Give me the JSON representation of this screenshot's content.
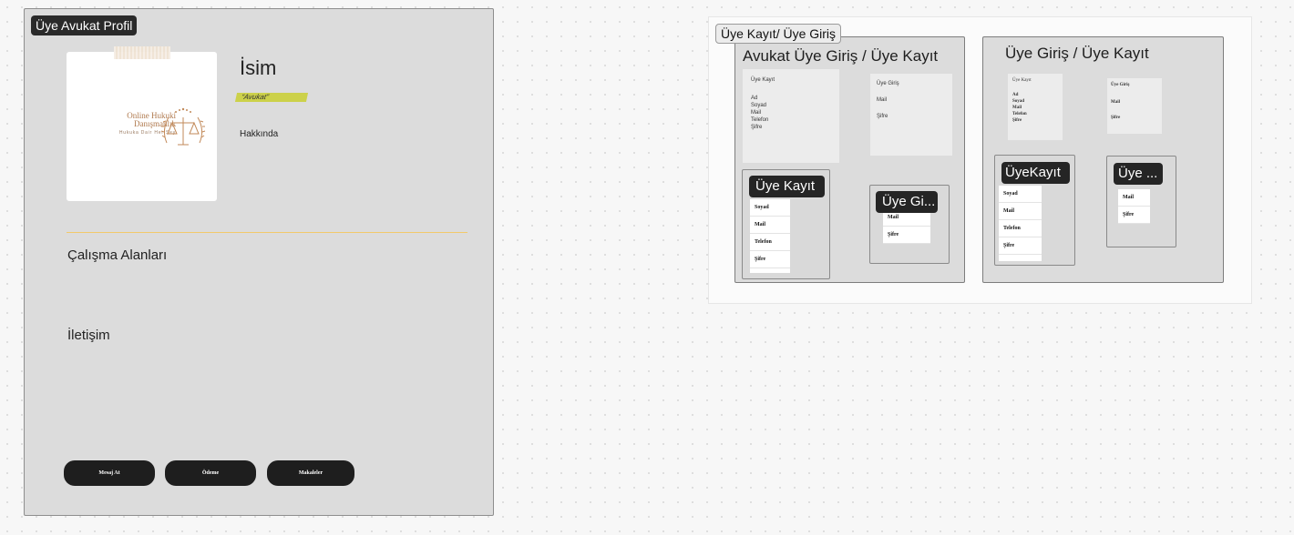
{
  "profile": {
    "frame_title": "Üye Avukat Profil",
    "logo": {
      "line1": "Online Hukuki",
      "line2": "Danışmanlık",
      "tagline": "Hukuka Dair Her Şey"
    },
    "name": "İsim",
    "role": "“Avukat”",
    "about": "Hakkında",
    "sections": {
      "areas": "Çalışma Alanları",
      "contact": "İletişim"
    },
    "buttons": {
      "message": "Mesaj At",
      "payment": "Ödeme",
      "articles": "Makaleler"
    }
  },
  "auth": {
    "frame_title": "Üye Kayıt/ Üye Giriş",
    "lawyer": {
      "title": "Avukat Üye Giriş / Üye Kayıt",
      "register_card": {
        "title": "Üye Kayıt",
        "fields": [
          "Ad",
          "Soyad",
          "Mail",
          "Telefon",
          "Şifre"
        ]
      },
      "login_card": {
        "title": "Üye Giriş",
        "fields": [
          "Mail",
          "Şifre"
        ]
      },
      "register_frame": {
        "label": "Üye Kayıt",
        "fields": [
          "Soyad",
          "Mail",
          "Telefon",
          "Şifre"
        ]
      },
      "login_frame": {
        "label": "Üye Gi...",
        "fields": [
          "Mail",
          "Şifre"
        ]
      }
    },
    "member": {
      "title": "Üye Giriş / Üye Kayıt",
      "register_card": {
        "title": "Üye Kayıt",
        "fields": [
          "Ad",
          "Soyad",
          "Mail",
          "Telefon",
          "Şifre"
        ]
      },
      "login_card": {
        "title": "Üye Giriş",
        "fields": [
          "Mail",
          "Şifre"
        ]
      },
      "register_frame": {
        "label": "ÜyeKayıt",
        "fields": [
          "Soyad",
          "Mail",
          "Telefon",
          "Şifre"
        ]
      },
      "login_frame": {
        "label": "Üye ...",
        "fields": [
          "Mail",
          "Şifre"
        ]
      }
    }
  },
  "colors": {
    "frame_bg": "#dcdcdc",
    "dark": "#1e1e1e",
    "accent_yellow": "#ccd14a",
    "divider": "#f2c96b",
    "logo_gold": "#b07a4f"
  }
}
